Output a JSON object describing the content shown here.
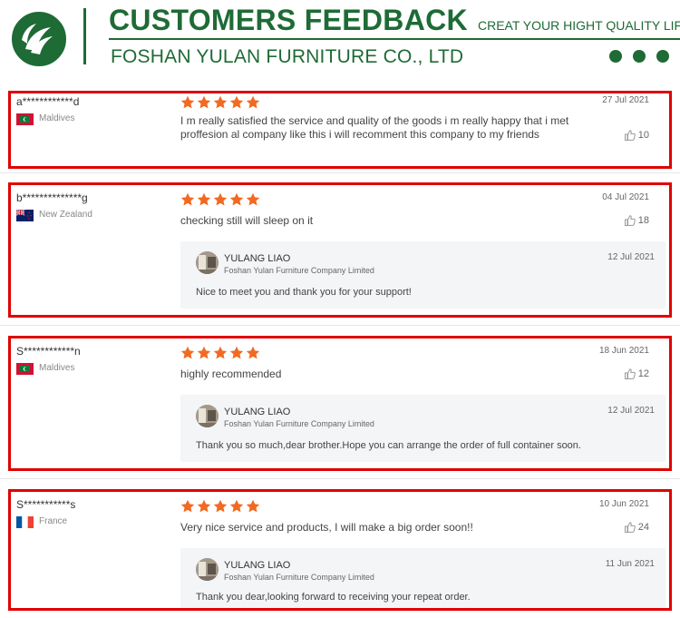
{
  "header": {
    "title": "CUSTOMERS FEEDBACK",
    "tagline": "CREAT YOUR HIGHT QUALITY LIFE",
    "company": "FOSHAN YULAN FURNITURE CO., LTD",
    "brand_color": "#1e6b35"
  },
  "rating_color": "#f26a22",
  "highlight_color": "#e00000",
  "reviews": [
    {
      "user": "a************d",
      "country": "Maldives",
      "flag": "maldives",
      "rating": 5,
      "date": "27 Jul 2021",
      "comment": "I m really satisfied the service and quality of the goods i m really happy that i met proffesion al company like this i will recomment this company to my friends",
      "likes": "10"
    },
    {
      "user": "b**************g",
      "country": "New Zealand",
      "flag": "new-zealand",
      "rating": 5,
      "date": "04 Jul 2021",
      "comment": "checking still will sleep on it",
      "likes": "18",
      "reply": {
        "name": "YULANG LIAO",
        "company": "Foshan Yulan Furniture Company Limited",
        "date": "12 Jul 2021",
        "text": "Nice to meet you and thank you for your support!"
      }
    },
    {
      "user": "S************n",
      "country": "Maldives",
      "flag": "maldives",
      "rating": 5,
      "date": "18 Jun 2021",
      "comment": "highly recommended",
      "likes": "12",
      "reply": {
        "name": "YULANG LIAO",
        "company": "Foshan Yulan Furniture Company Limited",
        "date": "12 Jul 2021",
        "text": "Thank you so much,dear brother.Hope you can arrange the order of full container soon."
      }
    },
    {
      "user": "S***********s",
      "country": "France",
      "flag": "france",
      "rating": 5,
      "date": "10 Jun 2021",
      "comment": "Very nice service and products, I will make a big order soon!!",
      "likes": "24",
      "reply": {
        "name": "YULANG LIAO",
        "company": "Foshan Yulan Furniture Company Limited",
        "date": "11 Jun 2021",
        "text": "Thank you dear,looking forward to receiving your repeat order."
      }
    }
  ]
}
